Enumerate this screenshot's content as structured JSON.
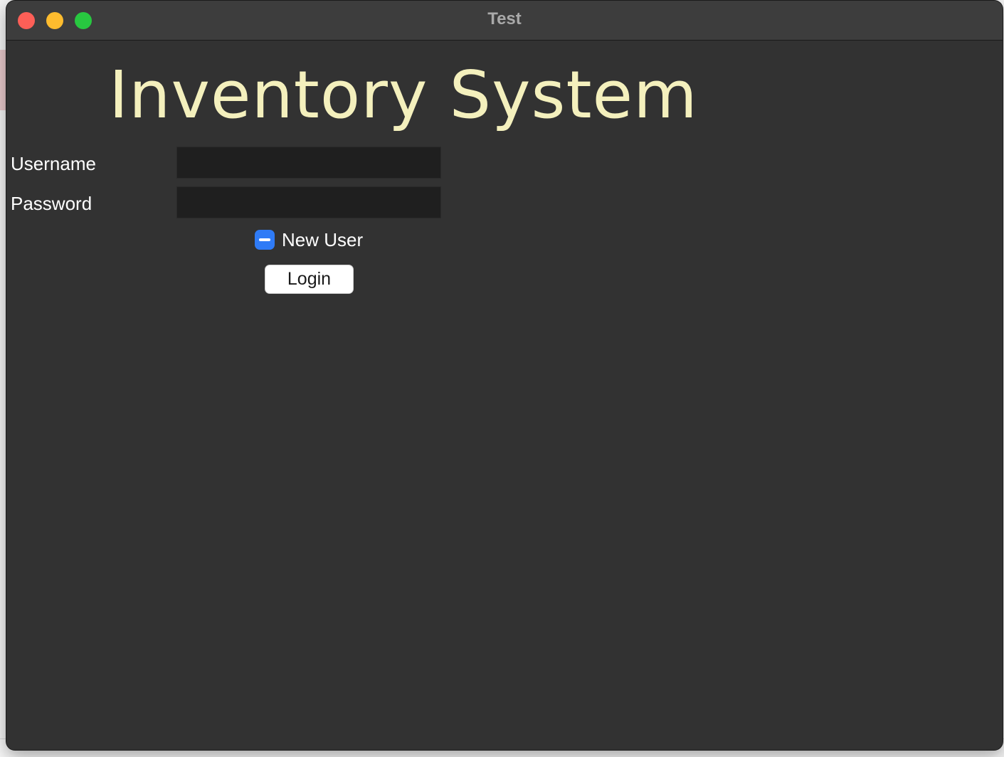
{
  "window": {
    "title": "Test",
    "controls": {
      "close": "close-icon",
      "minimize": "minimize-icon",
      "maximize": "maximize-icon"
    }
  },
  "app": {
    "heading": "Inventory System",
    "heading_color": "#f4f0bd"
  },
  "form": {
    "username": {
      "label": "Username",
      "value": "",
      "placeholder": ""
    },
    "password": {
      "label": "Password",
      "value": "",
      "placeholder": ""
    },
    "new_user": {
      "label": "New User",
      "state": "indeterminate"
    },
    "login_label": "Login"
  },
  "colors": {
    "window_bg": "#323232",
    "input_bg": "#1f1f1f",
    "checkbox_accent": "#2f7bf6"
  }
}
